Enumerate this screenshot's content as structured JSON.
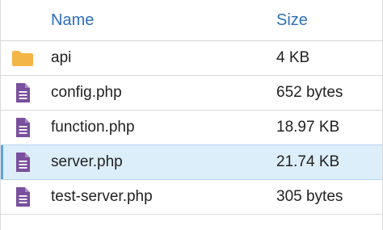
{
  "header": {
    "name_label": "Name",
    "size_label": "Size"
  },
  "files": [
    {
      "name": "api",
      "size": "4 KB",
      "icon": "folder-icon",
      "selected": false
    },
    {
      "name": "config.php",
      "size": "652 bytes",
      "icon": "document-icon",
      "selected": false
    },
    {
      "name": "function.php",
      "size": "18.97 KB",
      "icon": "document-icon",
      "selected": false
    },
    {
      "name": "server.php",
      "size": "21.74 KB",
      "icon": "document-icon",
      "selected": true
    },
    {
      "name": "test-server.php",
      "size": "305 bytes",
      "icon": "document-icon",
      "selected": false
    }
  ],
  "colors": {
    "header_text": "#2e6fb7",
    "folder": "#f4b547",
    "document": "#7a4f9e",
    "selected_bg": "#ddeefb",
    "selected_accent": "#5aa6e6"
  }
}
